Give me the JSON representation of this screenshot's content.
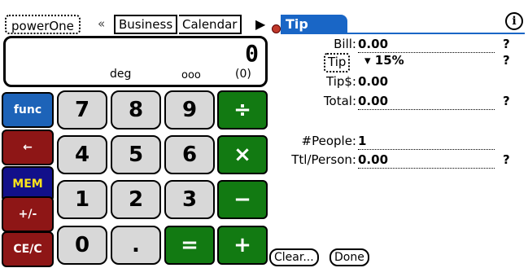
{
  "tabs": {
    "app": "powerOne",
    "prev_arrow": "«",
    "business": "Business",
    "calendar": "Calendar",
    "next_arrow": "▶"
  },
  "form": {
    "title": "Tip",
    "info": "i"
  },
  "display": {
    "value": "0",
    "mode": "deg",
    "digits": "ooo",
    "paren": "(0)"
  },
  "keys": {
    "func": "func",
    "back": "←",
    "mem": "MEM",
    "sign": "+/-",
    "clear": "CE/C",
    "k7": "7",
    "k8": "8",
    "k9": "9",
    "k4": "4",
    "k5": "5",
    "k6": "6",
    "k1": "1",
    "k2": "2",
    "k3": "3",
    "k0": "0",
    "dot": ".",
    "divide": "÷",
    "multiply": "×",
    "minus": "−",
    "equals": "=",
    "plus": "+"
  },
  "fields": {
    "bill_label": "Bill:",
    "bill_value": "0.00",
    "tip_label": "Tip",
    "tip_value": "▾ 15%",
    "tipd_label": "Tip$:",
    "tipd_value": "0.00",
    "total_label": "Total:",
    "total_value": "0.00",
    "people_label": "#People:",
    "people_value": "1",
    "ttl_label": "Ttl/Person:",
    "ttl_value": "0.00",
    "help": "?"
  },
  "buttons": {
    "clear": "Clear...",
    "done": "Done"
  },
  "colors": {
    "title_bar": "#1966c6",
    "func_key": "#1d63b8",
    "red_key": "#8e1616",
    "mem_key": "#12108a",
    "op_key": "#127a12",
    "num_key": "#d8d8d8"
  }
}
